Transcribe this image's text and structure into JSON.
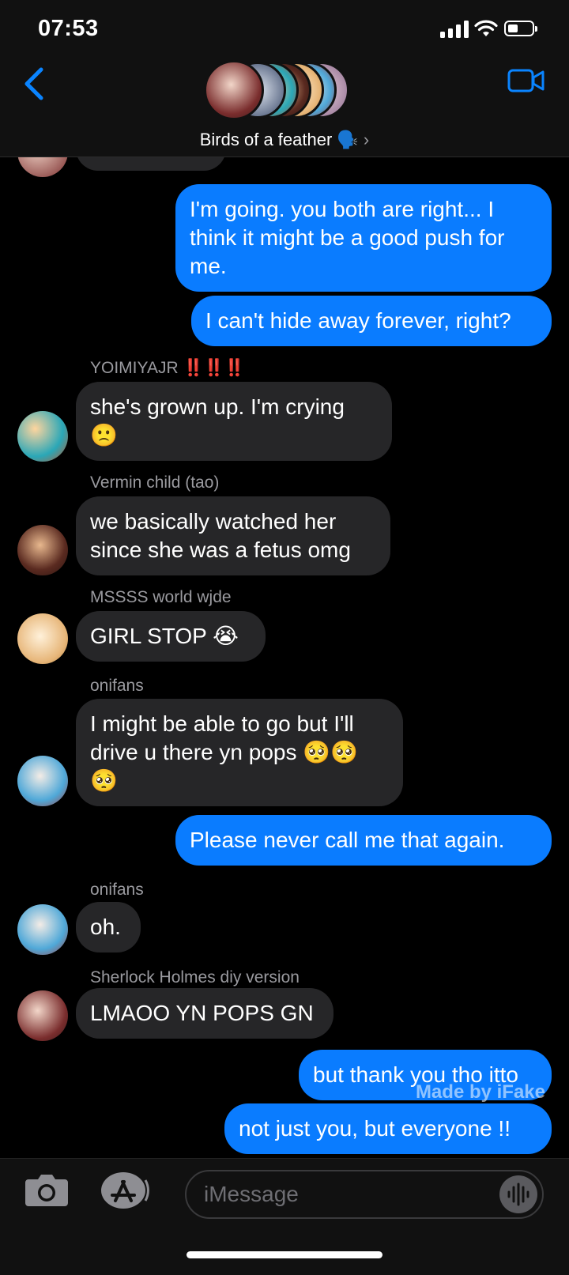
{
  "status_bar": {
    "time": "07:53"
  },
  "header": {
    "group_name": "Birds of a feather 🗣️"
  },
  "messages": [
    {
      "direction": "out",
      "text": "I'm going. you both are right... I think it might be a good push for me."
    },
    {
      "direction": "out",
      "text": "I can't hide away forever, right?"
    },
    {
      "direction": "in",
      "sender": "YOIMIYAJR ‼️‼️‼️",
      "text": "she's grown up. I'm crying\n🙁"
    },
    {
      "direction": "in",
      "sender": "Vermin child (tao)",
      "text": "we basically watched her\nsince she was a fetus omg"
    },
    {
      "direction": "in",
      "sender": "MSSSS world wjde",
      "text": "GIRL STOP 😭"
    },
    {
      "direction": "in",
      "sender": "onifans",
      "text": "I might be able to go but I'll\ndrive u there yn pops 🥺🥺\n🥺"
    },
    {
      "direction": "out",
      "text": "Please never call me that again."
    },
    {
      "direction": "in",
      "sender": "onifans",
      "text": "oh."
    },
    {
      "direction": "in",
      "sender": "Sherlock Holmes diy version",
      "text": "LMAOO YN POPS GN"
    },
    {
      "direction": "out",
      "text": "but thank you tho itto"
    },
    {
      "direction": "out",
      "text": "not just you, but everyone !!"
    }
  ],
  "watermark": "Made by iFake",
  "compose": {
    "placeholder": "iMessage"
  },
  "icons": [
    "back-chevron-icon",
    "video-call-icon",
    "camera-icon",
    "app-store-icon",
    "audio-waveform-icon",
    "signal-icon",
    "wifi-icon",
    "battery-icon"
  ],
  "colors": {
    "outgoing": "#0a7cff",
    "incoming": "#262628",
    "accent": "#0a84ff"
  }
}
